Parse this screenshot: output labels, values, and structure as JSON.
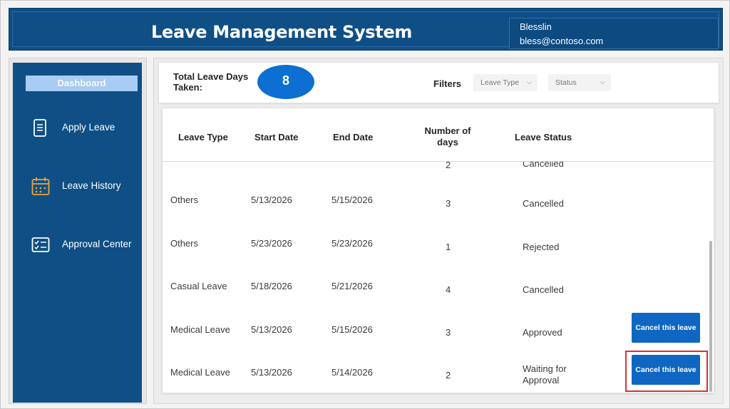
{
  "header": {
    "title": "Leave Management System",
    "user_name": "Blesslin",
    "user_email": "bless@contoso.com"
  },
  "sidebar": {
    "dashboard_label": "Dashboard",
    "items": [
      {
        "label": "Apply Leave",
        "icon": "document-icon"
      },
      {
        "label": "Leave History",
        "icon": "calendar-icon"
      },
      {
        "label": "Approval Center",
        "icon": "checklist-icon"
      }
    ]
  },
  "summary": {
    "total_label": "Total Leave Days Taken:",
    "total_value": "8",
    "filters_label": "Filters",
    "leave_type_placeholder": "Leave Type",
    "status_placeholder": "Status"
  },
  "table": {
    "columns": [
      "Leave Type",
      "Start Date",
      "End Date",
      "Number of days",
      "Leave Status"
    ],
    "partial_row": {
      "days": "2",
      "status": "Cancelled"
    },
    "rows": [
      {
        "type": "Others",
        "start": "5/13/2026",
        "end": "5/15/2026",
        "days": "3",
        "status": "Cancelled",
        "action": ""
      },
      {
        "type": "Others",
        "start": "5/23/2026",
        "end": "5/23/2026",
        "days": "1",
        "status": "Rejected",
        "action": ""
      },
      {
        "type": "Casual Leave",
        "start": "5/18/2026",
        "end": "5/21/2026",
        "days": "4",
        "status": "Cancelled",
        "action": ""
      },
      {
        "type": "Medical Leave",
        "start": "5/13/2026",
        "end": "5/15/2026",
        "days": "3",
        "status": "Approved",
        "action": "Cancel this leave"
      },
      {
        "type": "Medical Leave",
        "start": "5/13/2026",
        "end": "5/14/2026",
        "days": "2",
        "status": "Waiting for Approval",
        "action": "Cancel this leave"
      }
    ]
  },
  "colors": {
    "brand_blue": "#0f4f86",
    "accent_blue": "#0c6fd1",
    "button_blue": "#0f67c3",
    "highlight_red": "#d93030"
  }
}
